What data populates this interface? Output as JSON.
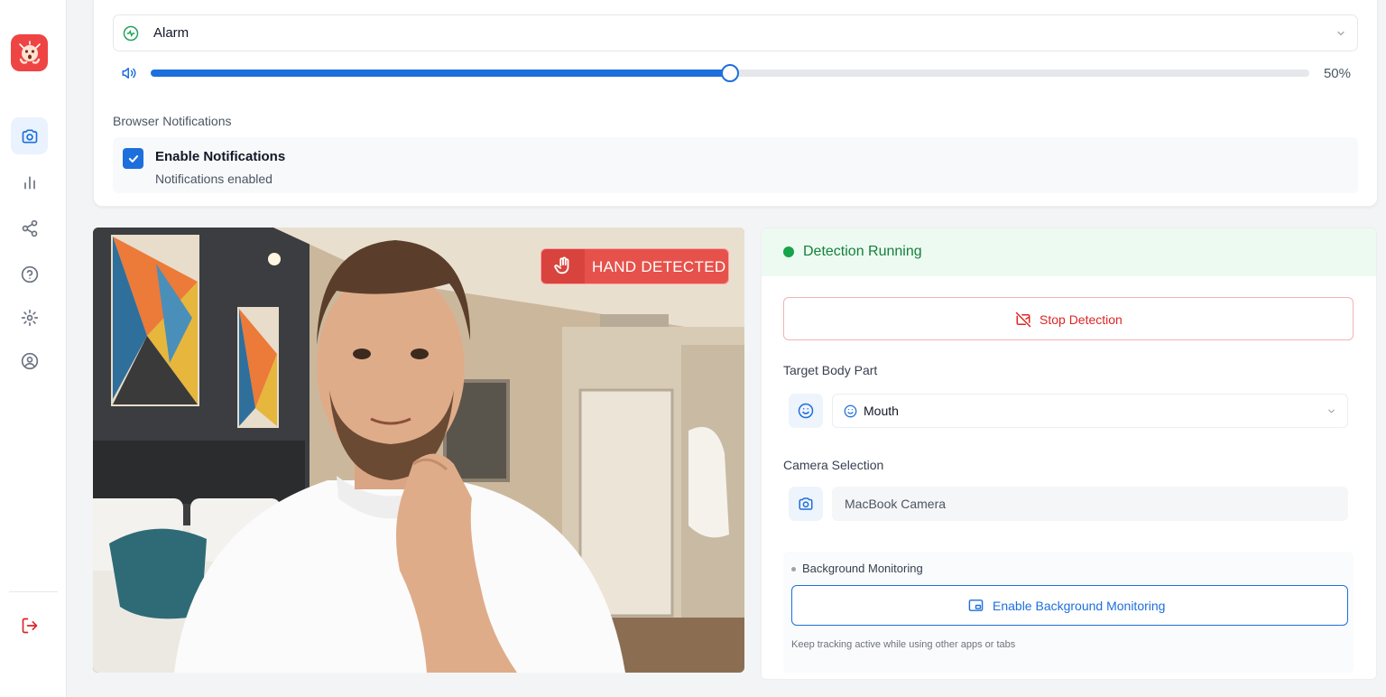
{
  "sidebar": {
    "logo_icon": "alarmed-face-logo",
    "nav": [
      {
        "icon": "camera-icon",
        "active": true
      },
      {
        "icon": "bar-chart-icon",
        "active": false
      },
      {
        "icon": "share-icon",
        "active": false
      },
      {
        "icon": "help-circle-icon",
        "active": false
      },
      {
        "icon": "settings-icon",
        "active": false
      },
      {
        "icon": "user-circle-icon",
        "active": false
      }
    ],
    "logout_icon": "logout-icon"
  },
  "alert_settings": {
    "sound_label": "Alarm",
    "volume_percent": 50,
    "volume_label": "50%",
    "notifications_heading": "Browser Notifications",
    "enable_notifications_label": "Enable Notifications",
    "enable_notifications_checked": true,
    "notifications_status": "Notifications enabled"
  },
  "camera_feed": {
    "badge_label": "HAND DETECTED"
  },
  "detection_panel": {
    "status_text": "Detection Running",
    "status_color": "#16a34a",
    "stop_button_label": "Stop Detection",
    "target_label": "Target Body Part",
    "target_value": "Mouth",
    "camera_label": "Camera Selection",
    "camera_value": "MacBook Camera",
    "background_title": "Background Monitoring",
    "background_button_label": "Enable Background Monitoring",
    "background_help": "Keep tracking active while using other apps or tabs"
  },
  "colors": {
    "accent": "#1d6fdc",
    "danger": "#dc2626",
    "success": "#16a34a"
  }
}
